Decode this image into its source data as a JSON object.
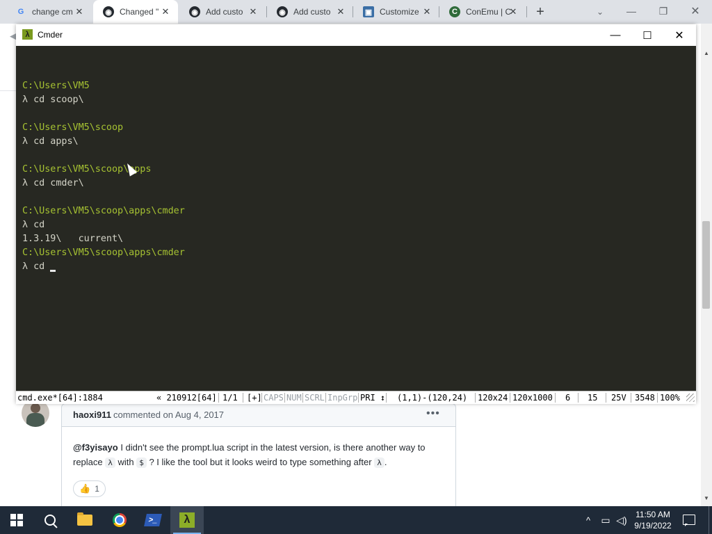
{
  "browser": {
    "tabs": [
      {
        "title": "change cm",
        "favicon": "google-icon"
      },
      {
        "title": "Changed \"",
        "favicon": "github-icon",
        "active": true
      },
      {
        "title": "Add custo",
        "favicon": "github-icon"
      },
      {
        "title": "Add custo",
        "favicon": "github-icon"
      },
      {
        "title": "Customize",
        "favicon": "site-image-icon"
      },
      {
        "title": "ConEmu | C",
        "favicon": "conemu-icon"
      }
    ],
    "new_tab": "+",
    "close_glyph": "✕"
  },
  "cmder": {
    "title": "Cmder",
    "icon_glyph": "λ",
    "console_lines": [
      {
        "type": "blank",
        "text": ""
      },
      {
        "type": "path",
        "text": "C:\\Users\\VM5"
      },
      {
        "type": "cmd",
        "text": "λ cd scoop\\"
      },
      {
        "type": "blank",
        "text": ""
      },
      {
        "type": "path",
        "text": "C:\\Users\\VM5\\scoop"
      },
      {
        "type": "cmd",
        "text": "λ cd apps\\"
      },
      {
        "type": "blank",
        "text": ""
      },
      {
        "type": "path",
        "text": "C:\\Users\\VM5\\scoop\\apps"
      },
      {
        "type": "cmd",
        "text": "λ cd cmder\\"
      },
      {
        "type": "blank",
        "text": ""
      },
      {
        "type": "path",
        "text": "C:\\Users\\VM5\\scoop\\apps\\cmder"
      },
      {
        "type": "cmd",
        "text": "λ cd"
      },
      {
        "type": "out",
        "text": "1.3.19\\   current\\"
      },
      {
        "type": "path",
        "text": "C:\\Users\\VM5\\scoop\\apps\\cmder"
      },
      {
        "type": "prompt",
        "text": "λ cd "
      }
    ],
    "status": {
      "process": "cmd.exe*[64]:1884",
      "pid_info": "« 210912[64]",
      "console_idx": "1/1",
      "plus": "[+]",
      "caps": "CAPS",
      "num": "NUM",
      "scrl": "SCRL",
      "inpgrp": "InpGrp",
      "pri": "PRI ↕",
      "selection": "(1,1)-(120,24)",
      "size": "120x24",
      "buffer": "120x1000",
      "n1": "6",
      "n2": "15",
      "n3": "25V",
      "n4": "3548",
      "zoom": "100%"
    }
  },
  "comment": {
    "author": "haoxi911",
    "meta": "commented on Aug 4, 2017",
    "mention": "@f3yisayo",
    "body_part1": " I didn't see the prompt.lua script in the latest version, is there another way to replace ",
    "code1": "λ",
    "body_part2": " with ",
    "code2": "$",
    "body_part3": " ? I like the tool but it looks weird to type something after ",
    "code3": "λ",
    "body_part4": ".",
    "reaction_emoji": "👍",
    "reaction_count": "1",
    "kebab": "•••"
  },
  "taskbar": {
    "apps": [
      "file-explorer-icon",
      "chrome-icon",
      "powershell-icon",
      "cmder-icon"
    ],
    "time": "11:50 AM",
    "date": "9/19/2022"
  }
}
